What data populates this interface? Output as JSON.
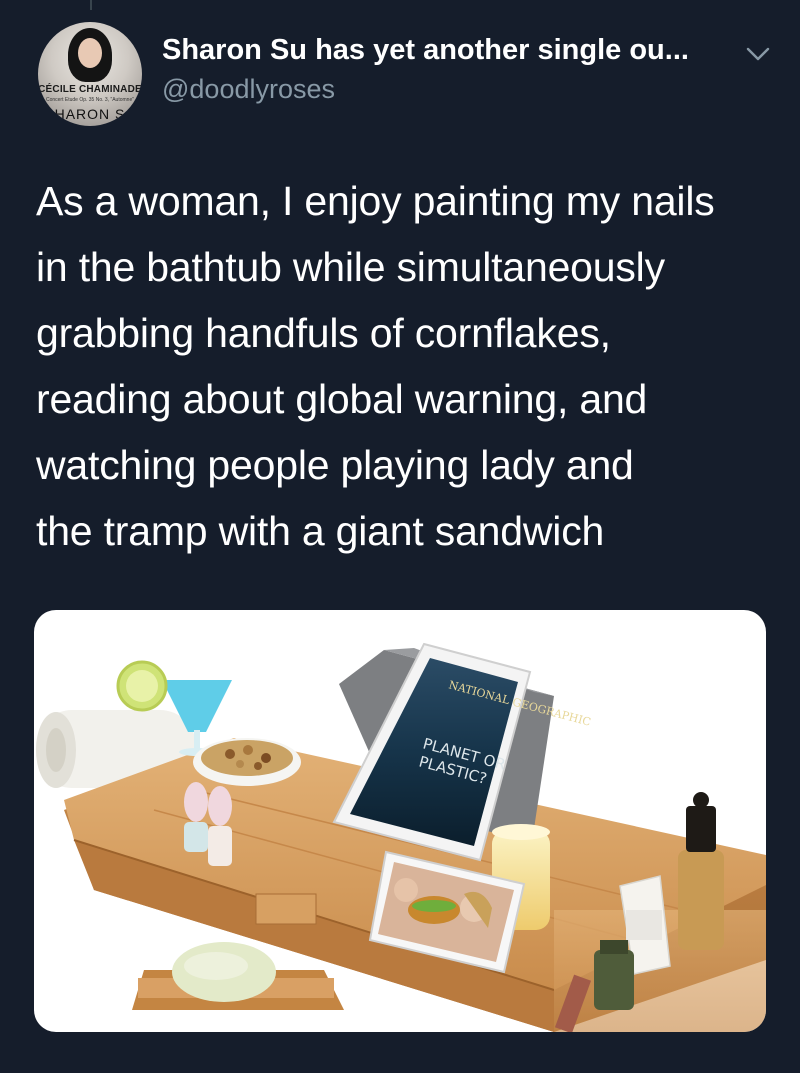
{
  "author": {
    "display_name": "Sharon Su has yet another single ou...",
    "handle": "@doodlyroses",
    "avatar_caption": {
      "line1": "CÉCILE CHAMINADE",
      "line2": "Concert Etude Op. 35 No. 3, \"Automne\"",
      "line3": "HARON S"
    }
  },
  "tweet": {
    "text_lines": [
      "As a woman, I enjoy painting my nails",
      "in the bathtub while simultaneously",
      "grabbing handfuls of cornflakes,",
      "reading about global warning, and",
      "watching people playing lady and",
      "the tramp with a giant sandwich"
    ]
  },
  "media": {
    "magazine_title": "NATIONAL GEOGRAPHIC",
    "magazine_headline_1": "PLANET OR",
    "magazine_headline_2": "PLASTIC?",
    "icons": [
      "chevron-down-icon"
    ]
  },
  "colors": {
    "background": "#151d2b",
    "primary_text": "#ffffff",
    "secondary_text": "#8899a6"
  }
}
